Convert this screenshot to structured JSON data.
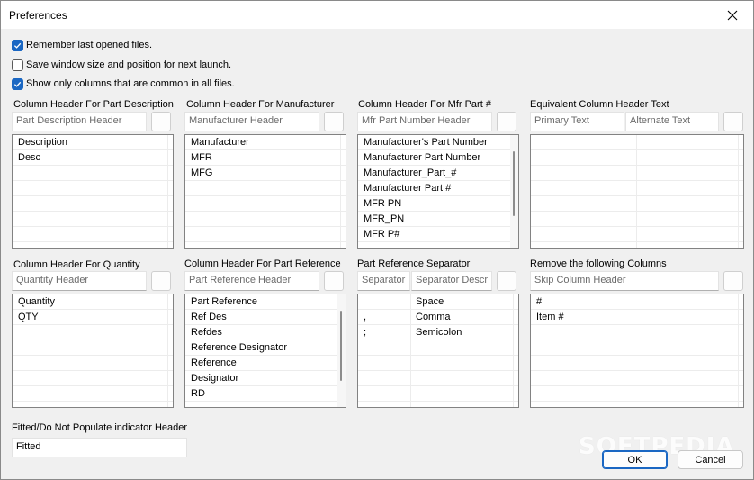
{
  "window": {
    "title": "Preferences"
  },
  "options": {
    "remember_files": {
      "label": "Remember last opened files.",
      "checked": true
    },
    "save_window": {
      "label": "Save window size and position for next launch.",
      "checked": false
    },
    "common_columns": {
      "label": "Show only columns that are common in all files.",
      "checked": true
    }
  },
  "part_description": {
    "label": "Column Header For Part Description",
    "placeholder": "Part Description Header",
    "items": [
      "Description",
      "Desc"
    ]
  },
  "manufacturer": {
    "label": "Column Header For Manufacturer",
    "placeholder": "Manufacturer Header",
    "items": [
      "Manufacturer",
      "MFR",
      "MFG"
    ]
  },
  "mfr_part": {
    "label": "Column Header For Mfr Part #",
    "placeholder": "Mfr Part Number Header",
    "items": [
      "Manufacturer's Part Number",
      "Manufacturer Part Number",
      "Manufacturer_Part_#",
      "Manufacturer Part #",
      "MFR PN",
      "MFR_PN",
      "MFR P#"
    ]
  },
  "equivalent": {
    "label": "Equivalent Column Header Text",
    "primary_placeholder": "Primary Text",
    "alternate_placeholder": "Alternate Text"
  },
  "quantity": {
    "label": "Column Header For Quantity",
    "placeholder": "Quantity Header",
    "items": [
      "Quantity",
      "QTY"
    ]
  },
  "part_reference": {
    "label": "Column Header For Part Reference",
    "placeholder": "Part Reference Header",
    "items": [
      "Part Reference",
      "Ref Des",
      "Refdes",
      "Reference Designator",
      "Reference",
      "Designator",
      "RD"
    ]
  },
  "separator": {
    "label": "Part Reference Separator",
    "separator_placeholder": "Separator",
    "description_placeholder": "Separator Description",
    "rows": [
      {
        "symbol": "",
        "name": "Space"
      },
      {
        "symbol": ",",
        "name": "Comma"
      },
      {
        "symbol": ";",
        "name": "Semicolon"
      }
    ]
  },
  "remove_columns": {
    "label": "Remove the following Columns",
    "placeholder": "Skip Column Header",
    "items": [
      "#",
      "Item #"
    ]
  },
  "fitted": {
    "label": "Fitted/Do Not Populate indicator Header",
    "value": "Fitted"
  },
  "buttons": {
    "ok": "OK",
    "cancel": "Cancel"
  },
  "watermark": "SOFTPEDIA",
  "colors": {
    "accent": "#1a67c3",
    "background": "#f0f0f0"
  }
}
